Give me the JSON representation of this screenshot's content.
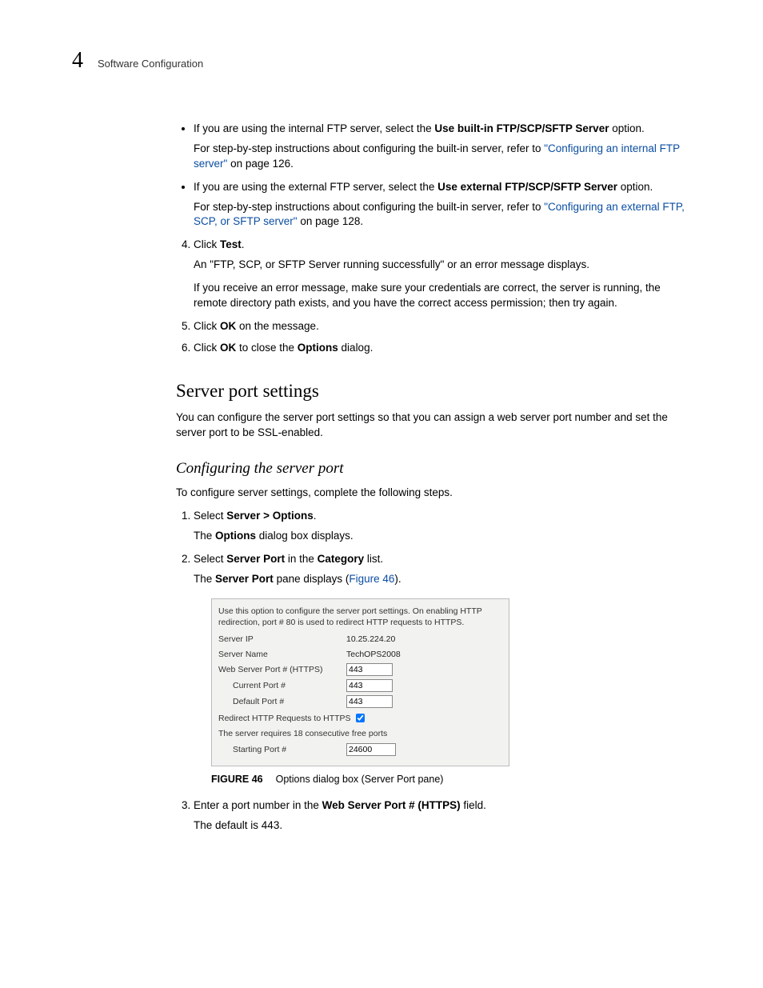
{
  "header": {
    "chapter_number": "4",
    "chapter_title": "Software Configuration"
  },
  "bullets": {
    "b1_prefix": "If you are using the internal FTP server, select the ",
    "b1_bold": "Use built-in FTP/SCP/SFTP Server",
    "b1_suffix": " option.",
    "b1_sub_prefix": "For step-by-step instructions about configuring the built-in server, refer to ",
    "b1_sub_link": "\"Configuring an internal FTP server\"",
    "b1_sub_suffix": " on page 126.",
    "b2_prefix": "If you are using the external FTP server, select the ",
    "b2_bold": "Use external FTP/SCP/SFTP Server",
    "b2_suffix": " option.",
    "b2_sub_prefix": "For step-by-step instructions about configuring the built-in server, refer to ",
    "b2_sub_link": "\"Configuring an external FTP, SCP, or SFTP server\"",
    "b2_sub_suffix": " on page 128."
  },
  "steps_a": {
    "s4_pre": "Click ",
    "s4_bold": "Test",
    "s4_post": ".",
    "s4_p1": "An \"FTP, SCP, or SFTP Server running successfully\" or an error message displays.",
    "s4_p2": "If you receive an error message, make sure your credentials are correct, the server is running, the remote directory path exists, and you have the correct access permission; then try again.",
    "s5_pre": "Click ",
    "s5_bold": "OK",
    "s5_post": " on the message.",
    "s6_pre": "Click ",
    "s6_bold1": "OK",
    "s6_mid": " to close the ",
    "s6_bold2": "Options",
    "s6_post": " dialog."
  },
  "section": {
    "title": "Server port settings",
    "intro": "You can configure the server port settings so that you can assign a web server port number and set the server port to be SSL-enabled.",
    "sub_title": "Configuring the server port",
    "sub_intro": "To configure server settings, complete the following steps."
  },
  "steps_b": {
    "s1_pre": "Select ",
    "s1_bold": "Server > Options",
    "s1_post": ".",
    "s1_p_pre": "The ",
    "s1_p_bold": "Options",
    "s1_p_post": " dialog box displays.",
    "s2_pre": "Select ",
    "s2_bold1": "Server Port",
    "s2_mid": " in the ",
    "s2_bold2": "Category",
    "s2_post": " list.",
    "s2_p_pre": "The ",
    "s2_p_bold": "Server Port",
    "s2_p_mid": " pane displays (",
    "s2_p_link": "Figure 46",
    "s2_p_post": ").",
    "s3_pre": "Enter a port number in the ",
    "s3_bold": "Web Server Port # (HTTPS)",
    "s3_post": " field.",
    "s3_p": "The default is 443."
  },
  "figure": {
    "desc": "Use this option to configure the server port settings. On enabling HTTP redirection, port # 80 is used to redirect HTTP requests to HTTPS.",
    "server_ip_label": "Server IP",
    "server_ip_value": "10.25.224.20",
    "server_name_label": "Server Name",
    "server_name_value": "TechOPS2008",
    "web_port_label": "Web Server Port # (HTTPS)",
    "web_port_value": "443",
    "current_port_label": "Current Port #",
    "current_port_value": "443",
    "default_port_label": "Default Port #",
    "default_port_value": "443",
    "redirect_label": "Redirect HTTP Requests to HTTPS",
    "free_ports_label": "The server requires 18 consecutive free ports",
    "starting_port_label": "Starting Port #",
    "starting_port_value": "24600",
    "caption_label": "FIGURE 46",
    "caption_text": "Options dialog box (Server Port pane)"
  }
}
